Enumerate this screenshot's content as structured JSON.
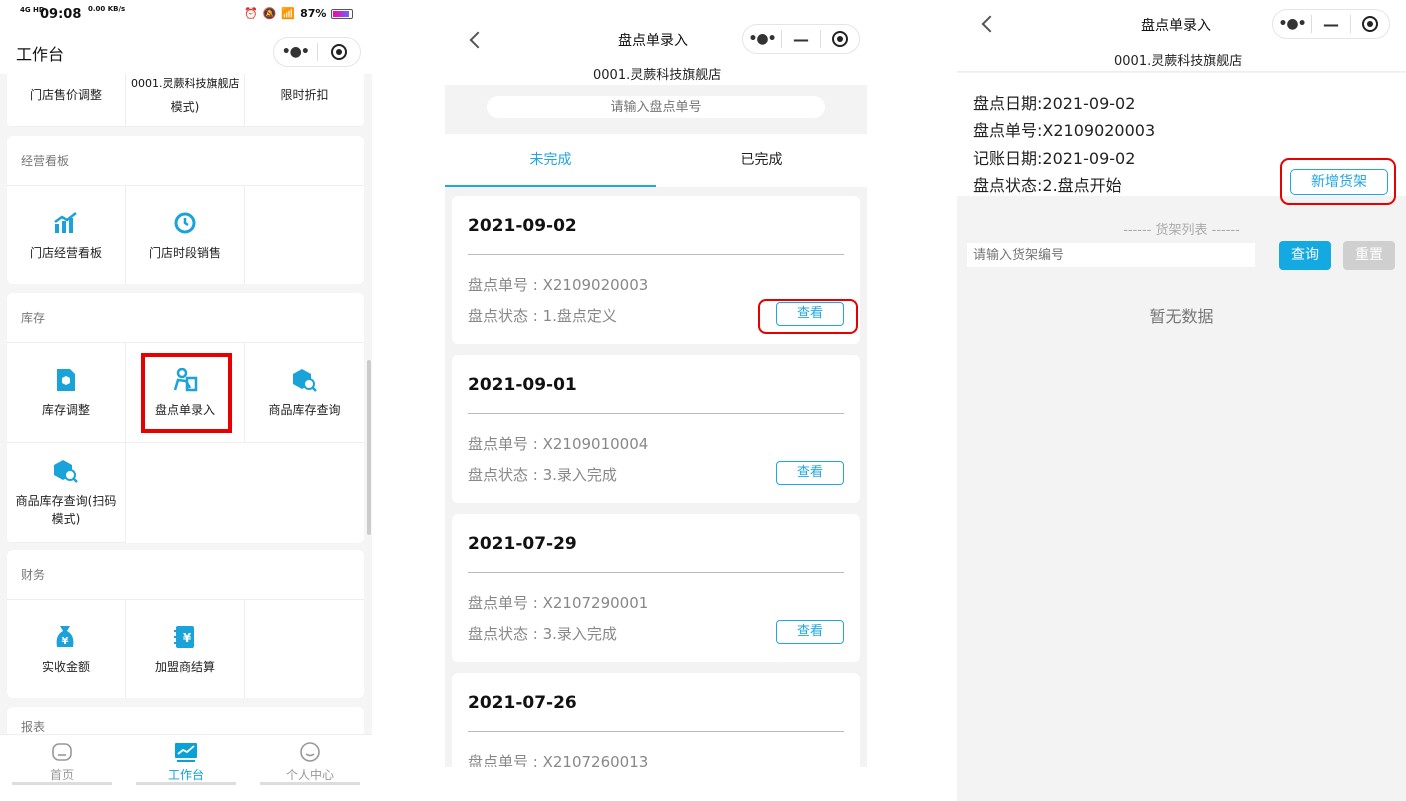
{
  "phone1": {
    "status": {
      "signal": "4G HD",
      "time": "09:08",
      "speed": "0.00 KB/s",
      "battery_text": "87%",
      "battery_level": 0.87
    },
    "header": {
      "title": "工作台"
    },
    "floating_shop": "0001.灵蕨科技旗舰店",
    "top_items": [
      "门店售价调整",
      "模式)",
      "限时折扣"
    ],
    "sections": [
      {
        "title": "经营看板",
        "items": [
          "门店经营看板",
          "门店时段销售"
        ]
      },
      {
        "title": "库存",
        "items": [
          "库存调整",
          "盘点单录入",
          "商品库存查询",
          "商品库存查询(扫码模式)"
        ]
      },
      {
        "title": "财务",
        "items": [
          "实收金额",
          "加盟商结算"
        ]
      },
      {
        "title": "报表"
      }
    ],
    "tabbar": [
      "首页",
      "工作台",
      "个人中心"
    ]
  },
  "phone2": {
    "title": "盘点单录入",
    "shop": "0001.灵蕨科技旗舰店",
    "search_placeholder": "请输入盘点单号",
    "tabs": [
      "未完成",
      "已完成"
    ],
    "records": [
      {
        "date": "2021-09-02",
        "no": "盘点单号 : X2109020003",
        "status": "盘点状态 : 1.盘点定义",
        "btn": "查看"
      },
      {
        "date": "2021-09-01",
        "no": "盘点单号 : X2109010004",
        "status": "盘点状态 : 3.录入完成",
        "btn": "查看"
      },
      {
        "date": "2021-07-29",
        "no": "盘点单号 : X2107290001",
        "status": "盘点状态 : 3.录入完成",
        "btn": "查看"
      },
      {
        "date": "2021-07-26",
        "no": "盘点单号 : X2107260013"
      }
    ]
  },
  "phone3": {
    "title": "盘点单录入",
    "shop": "0001.灵蕨科技旗舰店",
    "info": [
      "盘点日期:2021-09-02",
      "盘点单号:X2109020003",
      "记账日期:2021-09-02",
      "盘点状态:2.盘点开始"
    ],
    "add_shelf": "新增货架",
    "shelf_list_title": "------   货架列表   ------",
    "shelf_placeholder": "请输入货架编号",
    "query": "查询",
    "reset": "重置",
    "empty": "暂无数据"
  },
  "colors": {
    "accent": "#1ea7e1",
    "highlight": "#e60000"
  }
}
